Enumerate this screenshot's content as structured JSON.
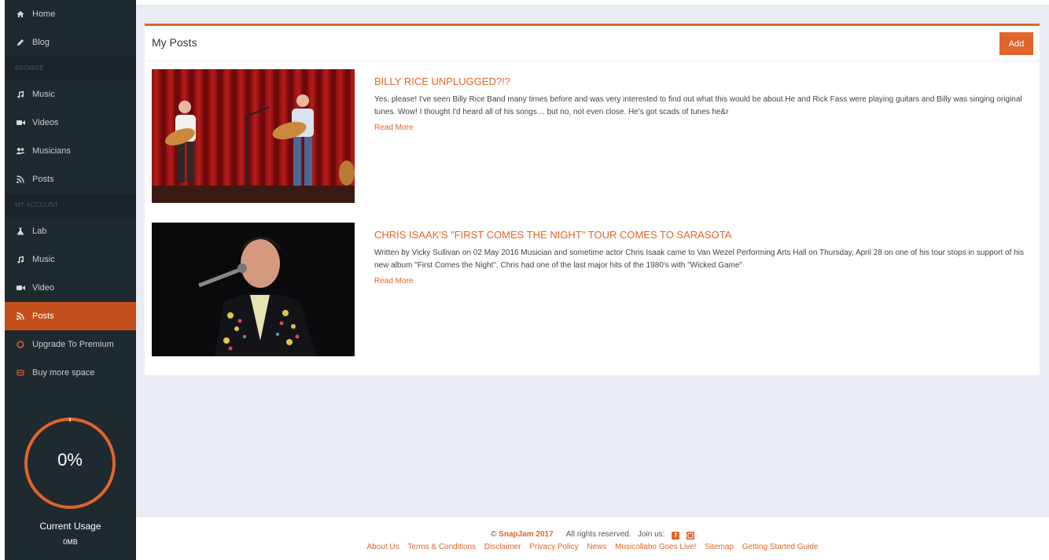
{
  "sidebar": {
    "top_items": [
      {
        "label": "Home",
        "icon": "home-icon"
      },
      {
        "label": "Blog",
        "icon": "pencil-icon"
      }
    ],
    "browse_header": "BROWSE",
    "browse_items": [
      {
        "label": "Music",
        "icon": "music-icon"
      },
      {
        "label": "Videos",
        "icon": "video-camera-icon"
      },
      {
        "label": "Musicians",
        "icon": "users-icon"
      },
      {
        "label": "Posts",
        "icon": "rss-icon"
      }
    ],
    "account_header": "MY ACCOUNT",
    "account_items": [
      {
        "label": "Lab",
        "icon": "flask-icon"
      },
      {
        "label": "Music",
        "icon": "music-icon"
      },
      {
        "label": "Video",
        "icon": "video-camera-icon"
      },
      {
        "label": "Posts",
        "icon": "rss-icon",
        "active": true
      },
      {
        "label": "Upgrade To Premium",
        "icon": "circle-icon"
      },
      {
        "label": "Buy more space",
        "icon": "hdd-icon"
      }
    ],
    "usage": {
      "percent_label": "0%",
      "percent": 0,
      "label": "Current Usage",
      "amount": "0MB"
    }
  },
  "main": {
    "title": "My Posts",
    "add_label": "Add",
    "posts": [
      {
        "title": "BILLY RICE UNPLUGGED?!?",
        "excerpt": "Yes, please!  I've seen Billy Rice Band many times before and was very interested to find out what this would be about.He and Rick Fass were playing guitars and Billy was singing original tunes. Wow! I thought I'd heard all of his songs… but no, not even close. He's got scads of tunes he&r",
        "read_more": "Read More"
      },
      {
        "title": "CHRIS ISAAK'S \"FIRST COMES THE NIGHT\" TOUR COMES TO SARASOTA",
        "excerpt": "Written by Vicky Sullivan on 02 May 2016 Musician and sometime actor Chris Isaak came to Van Wezel Performing Arts Hall on Thursday, April 28 on one of his tour stops in support of his new album \"First Comes the Night\". Chris had one of the last major hits of the 1980's with \"Wicked Game\"",
        "read_more": "Read More"
      }
    ]
  },
  "footer": {
    "copyright_symbol": "©",
    "brand": "SnapJam 2017",
    "rights": "All rights reserved.",
    "join": "Join us:",
    "links": [
      "About Us",
      "Terms & Conditions",
      "Disclaimer",
      "Privacy Policy",
      "News",
      "Musicollabo Goes Live!",
      "Sitemap",
      "Getting Started Guide"
    ]
  },
  "colors": {
    "accent": "#e0652b",
    "sidebar_bg": "#1f2a30",
    "active_bg": "#c3501a",
    "main_bg": "#e9edf3"
  }
}
